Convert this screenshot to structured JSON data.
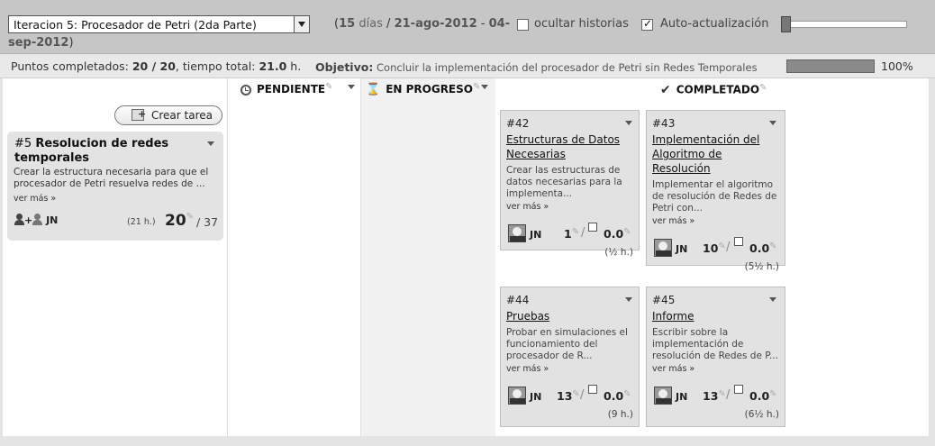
{
  "toolbar": {
    "iteration_select": "Iteracion 5: Procesador de Petri (2da Parte)",
    "days": "15",
    "days_word": "días",
    "date_start": "21-ago-2012",
    "date_end_line1": "04-",
    "date_end_line2": "sep-2012",
    "hide_stories_label": "ocultar historias",
    "hide_stories_checked": false,
    "auto_refresh_label": "Auto-actualización",
    "auto_refresh_checked": true,
    "slider_level": 0
  },
  "summary": {
    "points_label": "Puntos completados:",
    "points_value": "20 / 20",
    "time_label": "tiempo total:",
    "time_value": "21.0",
    "time_unit": "h.",
    "goal_label": "Objetivo:",
    "goal_text": "Concluir la implementación del procesador de Petri sin Redes Temporales",
    "progress_percent": 100,
    "progress_label": "100%"
  },
  "columns": {
    "pending": "PENDIENTE",
    "in_progress": "EN PROGRESO",
    "done": "COMPLETADO"
  },
  "story_column": {
    "create_task_label": "Crear tarea",
    "story": {
      "number": "#5",
      "title": "Resolucion de redes temporales",
      "description": "Crear la estructura necesaria para que el procesador de Petri resuelva redes de ...",
      "more": "ver más »",
      "users": "JN",
      "hours": "(21 h.)",
      "points": "20",
      "total": "/ 37"
    }
  },
  "tasks": [
    {
      "number": "#42",
      "name": "Estructuras de Datos Necesarias",
      "description": "Crear las estructuras de datos necesarias para la implementa...",
      "more": "ver más »",
      "user": "JN",
      "points": "1",
      "remaining": "0.0",
      "hours": "(½ h.)"
    },
    {
      "number": "#43",
      "name": "Implementación del Algoritmo de Resolución",
      "description": "Implementar el algoritmo de resolución de Redes de Petri con...",
      "more": "ver más »",
      "user": "JN",
      "points": "10",
      "remaining": "0.0",
      "hours": "(5½ h.)"
    },
    {
      "number": "#44",
      "name": "Pruebas",
      "description": "Probar en simulaciones el funcionamiento del procesador de R...",
      "more": "ver más »",
      "user": "JN",
      "points": "13",
      "remaining": "0.0",
      "hours": "(9 h.)"
    },
    {
      "number": "#45",
      "name": "Informe",
      "description": "Escribir sobre la implementación de resolución de Redes de P...",
      "more": "ver más »",
      "user": "JN",
      "points": "13",
      "remaining": "0.0",
      "hours": "(6½ h.)"
    }
  ],
  "colors": {
    "toolbar_bg": "#c6c6c6",
    "card_bg": "#e2e2e2",
    "progress_fill": "#8a8a8a"
  }
}
